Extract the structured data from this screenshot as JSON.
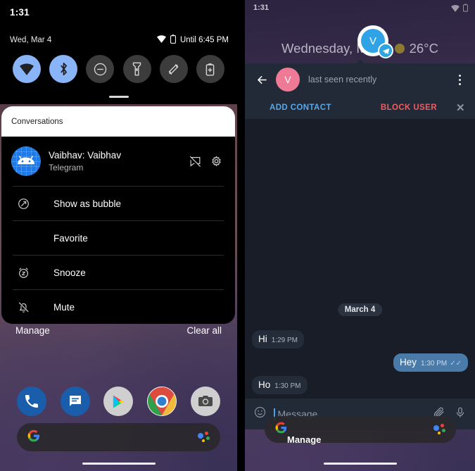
{
  "left_panel": {
    "status_bar": {
      "clock": "1:31"
    },
    "quick_settings": {
      "date": "Wed, Mar 4",
      "battery_status": "Until 6:45 PM",
      "wifi_icon": "wifi-icon",
      "battery_icon": "battery-icon",
      "tiles": [
        {
          "name": "wifi",
          "label": "Wi-Fi",
          "active": true
        },
        {
          "name": "bluetooth",
          "label": "Bluetooth",
          "active": true
        },
        {
          "name": "dnd",
          "label": "Do Not Disturb",
          "active": false
        },
        {
          "name": "flashlight",
          "label": "Flashlight",
          "active": false
        },
        {
          "name": "auto-rotate",
          "label": "Auto-rotate",
          "active": false
        },
        {
          "name": "battery-saver",
          "label": "Battery Saver",
          "active": false
        }
      ]
    },
    "notification": {
      "section_header": "Conversations",
      "title": "Vaibhav: Vaibhav",
      "app_name": "Telegram",
      "avatar_icon": "android-robot-icon",
      "action_icons": [
        "silence-notification-icon",
        "settings-gear-icon"
      ],
      "menu": [
        {
          "label": "Show as bubble",
          "icon": "bubble-icon"
        },
        {
          "label": "Favorite",
          "icon": "none"
        },
        {
          "label": "Snooze",
          "icon": "snooze-alarm-icon"
        },
        {
          "label": "Mute",
          "icon": "bell-off-icon"
        }
      ]
    },
    "footer": {
      "manage": "Manage",
      "clear_all": "Clear all"
    },
    "dock": [
      {
        "name": "phone",
        "label": "Phone"
      },
      {
        "name": "messages",
        "label": "Messages"
      },
      {
        "name": "play-store",
        "label": "Play Store"
      },
      {
        "name": "chrome",
        "label": "Chrome"
      },
      {
        "name": "camera",
        "label": "Camera"
      }
    ],
    "search_bar": {
      "logo": "google-g-icon",
      "assistant": "assistant-dots-icon"
    }
  },
  "right_panel": {
    "status_bar": {
      "clock": "1:31"
    },
    "widget": {
      "date": "Wednesday, Mar 4",
      "weather_icon": "sun-icon",
      "temperature": "26°C"
    },
    "bubble": {
      "initial": "V",
      "badge_icon": "telegram-icon"
    },
    "chat": {
      "back_icon": "back-arrow-icon",
      "avatar_initial": "V",
      "subtitle": "last seen recently",
      "overflow_icon": "kebab-menu-icon",
      "actions": {
        "add_contact": "ADD CONTACT",
        "block_user": "BLOCK USER",
        "close_icon": "close-icon"
      },
      "day_separator": "March 4",
      "messages": [
        {
          "text": "Hi",
          "time": "1:29 PM",
          "direction": "in",
          "ticks": ""
        },
        {
          "text": "Hey",
          "time": "1:30 PM",
          "direction": "out",
          "ticks": "✓✓"
        },
        {
          "text": "Ho",
          "time": "1:30 PM",
          "direction": "in",
          "ticks": ""
        }
      ],
      "composer": {
        "emoji_icon": "emoji-smiley-icon",
        "placeholder": "Message",
        "value": "",
        "attach_icon": "paperclip-icon",
        "mic_icon": "microphone-icon"
      }
    },
    "overlay": {
      "manage": "Manage"
    },
    "search_bar": {
      "logo": "google-g-icon",
      "assistant": "assistant-dots-icon"
    }
  },
  "colors": {
    "accent_blue": "#8ab4f8",
    "chat_bg": "#181d27",
    "chat_header": "#222a38",
    "bubble_out": "#4a7aa8",
    "bubble_in": "#242c3a",
    "add_contact": "#5aa7e8",
    "block_user": "#ef5d62",
    "avatar_pink": "#ef7a95",
    "telegram_blue": "#2ca5e0"
  }
}
